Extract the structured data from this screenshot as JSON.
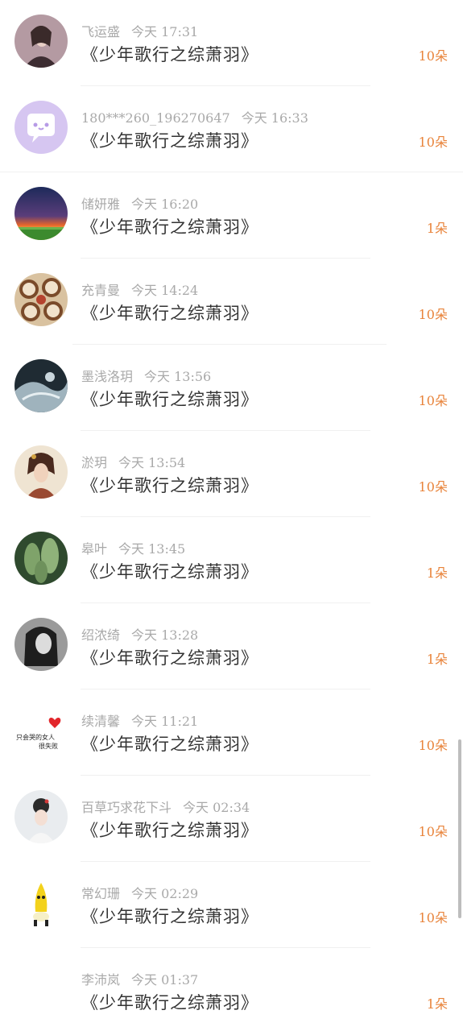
{
  "items": [
    {
      "name": "飞运盛",
      "time": "今天 17:31",
      "title": "《少年歌行之综萧羽》",
      "count": "10朵",
      "avatar_icon": "girl-portrait-avatar"
    },
    {
      "name": "180***260_196270647",
      "time": "今天 16:33",
      "title": "《少年歌行之综萧羽》",
      "count": "10朵",
      "avatar_icon": "default-chat-avatar"
    },
    {
      "name": "储妍雅",
      "time": "今天 16:20",
      "title": "《少年歌行之综萧羽》",
      "count": "1朵",
      "avatar_icon": "sunset-landscape-avatar"
    },
    {
      "name": "充青曼",
      "time": "今天 14:24",
      "title": "《少年歌行之综萧羽》",
      "count": "10朵",
      "avatar_icon": "latte-art-avatar"
    },
    {
      "name": "墨浅洛玥",
      "time": "今天 13:56",
      "title": "《少年歌行之综萧羽》",
      "count": "10朵",
      "avatar_icon": "ink-painting-avatar"
    },
    {
      "name": "淤玥",
      "time": "今天 13:54",
      "title": "《少年歌行之综萧羽》",
      "count": "10朵",
      "avatar_icon": "ancient-lady-avatar"
    },
    {
      "name": "皋叶",
      "time": "今天 13:45",
      "title": "《少年歌行之综萧羽》",
      "count": "1朵",
      "avatar_icon": "cactus-plant-avatar"
    },
    {
      "name": "绍浓绮",
      "time": "今天 13:28",
      "title": "《少年歌行之综萧羽》",
      "count": "1朵",
      "avatar_icon": "bw-girl-avatar"
    },
    {
      "name": "续清馨",
      "time": "今天 11:21",
      "title": "《少年歌行之综萧羽》",
      "count": "10朵",
      "avatar_icon": "heart-text-avatar",
      "avatar_text": "只会哭的女人 很失败"
    },
    {
      "name": "百草巧求花下斗",
      "time": "今天 02:34",
      "title": "《少年歌行之综萧羽》",
      "count": "10朵",
      "avatar_icon": "hanfu-girl-avatar"
    },
    {
      "name": "常幻珊",
      "time": "今天 02:29",
      "title": "《少年歌行之综萧羽》",
      "count": "10朵",
      "avatar_icon": "banana-character-avatar"
    },
    {
      "name": "李沛岚",
      "time": "今天 01:37",
      "title": "《少年歌行之综萧羽》",
      "count": "1朵",
      "avatar_icon": "blank-avatar"
    }
  ]
}
